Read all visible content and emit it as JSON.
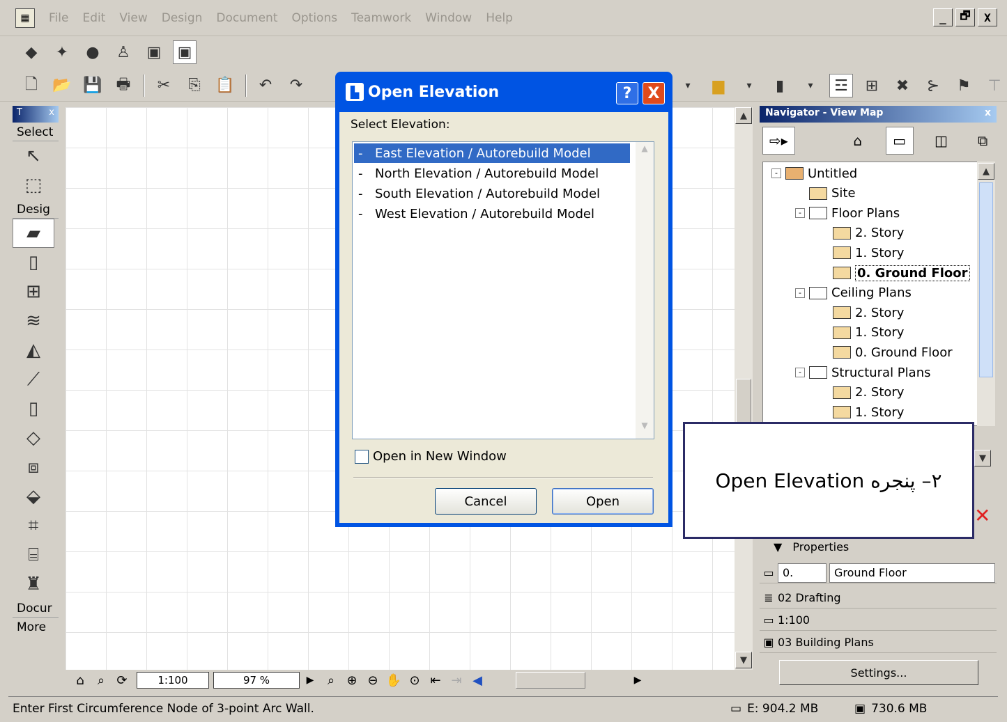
{
  "menu": {
    "items": [
      "File",
      "Edit",
      "View",
      "Design",
      "Document",
      "Options",
      "Teamwork",
      "Window",
      "Help"
    ],
    "window_controls": [
      "_",
      "🗗",
      "X"
    ]
  },
  "toolbox": {
    "title": "T",
    "close": "x",
    "select_label": "Select",
    "design_label": "Desig",
    "document_label": "Docur",
    "more_label": "More"
  },
  "canvas_bar": {
    "scale": "1:100",
    "zoom": "97 %"
  },
  "status": {
    "message": "Enter First Circumference Node of 3-point Arc Wall.",
    "disk": "E: 904.2 MB",
    "memory": "730.6 MB"
  },
  "navigator": {
    "title": "Navigator - View Map",
    "close": "x",
    "tree": [
      {
        "label": "Untitled",
        "level": 0,
        "icon": "home",
        "expander": "-"
      },
      {
        "label": "Site",
        "level": 1,
        "icon": "folder",
        "expander": ""
      },
      {
        "label": "Floor Plans",
        "level": 1,
        "icon": "set",
        "expander": "-"
      },
      {
        "label": "2. Story",
        "level": 2,
        "icon": "folder",
        "expander": ""
      },
      {
        "label": "1. Story",
        "level": 2,
        "icon": "folder",
        "expander": ""
      },
      {
        "label": "0. Ground Floor",
        "level": 2,
        "icon": "folder",
        "expander": "",
        "selected": true
      },
      {
        "label": "Ceiling Plans",
        "level": 1,
        "icon": "set",
        "expander": "-"
      },
      {
        "label": "2. Story",
        "level": 2,
        "icon": "folder",
        "expander": ""
      },
      {
        "label": "1. Story",
        "level": 2,
        "icon": "folder",
        "expander": ""
      },
      {
        "label": "0. Ground Floor",
        "level": 2,
        "icon": "folder",
        "expander": ""
      },
      {
        "label": "Structural Plans",
        "level": 1,
        "icon": "set",
        "expander": "-"
      },
      {
        "label": "2. Story",
        "level": 2,
        "icon": "folder",
        "expander": ""
      },
      {
        "label": "1. Story",
        "level": 2,
        "icon": "folder",
        "expander": ""
      }
    ],
    "properties_label": "Properties",
    "story_number": "0.",
    "story_name": "Ground Floor",
    "layer": "02 Drafting",
    "scale": "1:100",
    "pen_set": "03 Building Plans",
    "settings_label": "Settings..."
  },
  "dialog": {
    "title": "Open Elevation",
    "help": "?",
    "close": "X",
    "select_label": "Select Elevation:",
    "items": [
      {
        "dash": "-",
        "label": "East Elevation / Autorebuild Model",
        "selected": true
      },
      {
        "dash": "-",
        "label": "North Elevation / Autorebuild Model"
      },
      {
        "dash": "-",
        "label": "South Elevation / Autorebuild Model"
      },
      {
        "dash": "-",
        "label": "West Elevation / Autorebuild Model"
      }
    ],
    "new_window_label": "Open in New Window",
    "cancel_label": "Cancel",
    "open_label": "Open"
  },
  "callout": {
    "text": "۲– پنجره Open Elevation"
  },
  "colors": {
    "dialog_title_bar": "#0054e3",
    "selection": "#316ac5",
    "callout_border": "#2b2b66"
  }
}
